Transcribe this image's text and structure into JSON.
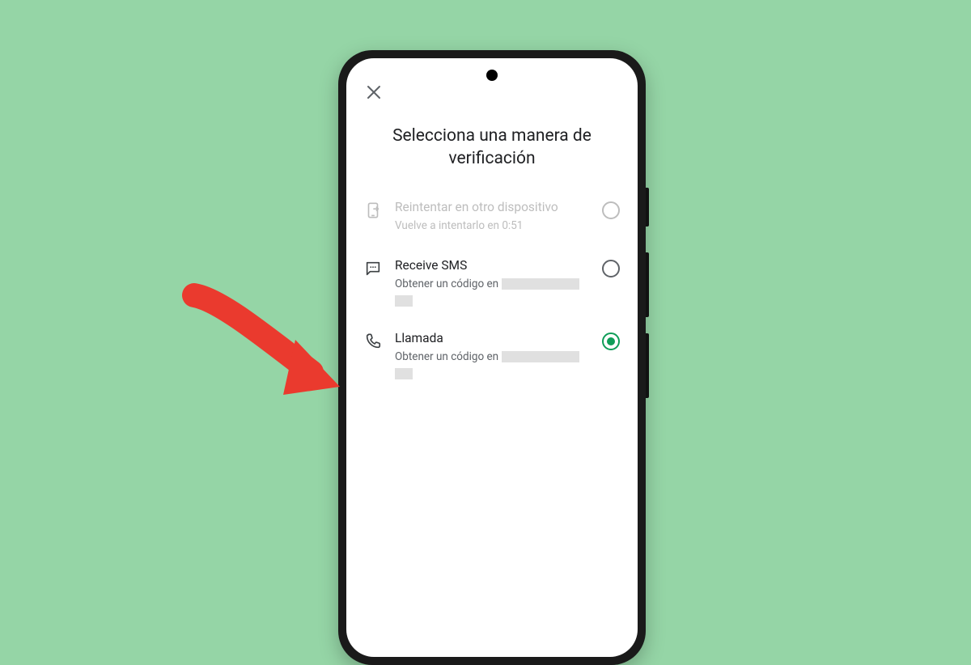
{
  "title": "Selecciona una manera de verificación",
  "options": {
    "retry": {
      "title": "Reintentar en otro dispositivo",
      "subtitle": "Vuelve a intentarlo en 0:51",
      "disabled": true,
      "selected": false,
      "icon": "device-arrow-icon"
    },
    "sms": {
      "title": "Receive SMS",
      "subtitle_prefix": "Obtener un código en",
      "disabled": false,
      "selected": false,
      "icon": "sms-icon"
    },
    "call": {
      "title": "Llamada",
      "subtitle_prefix": "Obtener un código en",
      "disabled": false,
      "selected": true,
      "icon": "phone-icon"
    }
  },
  "colors": {
    "background": "#95d5a6",
    "accent_selected": "#0f9d58",
    "arrow": "#ea4335"
  },
  "annotation": {
    "type": "arrow",
    "points_to": "option-call"
  }
}
